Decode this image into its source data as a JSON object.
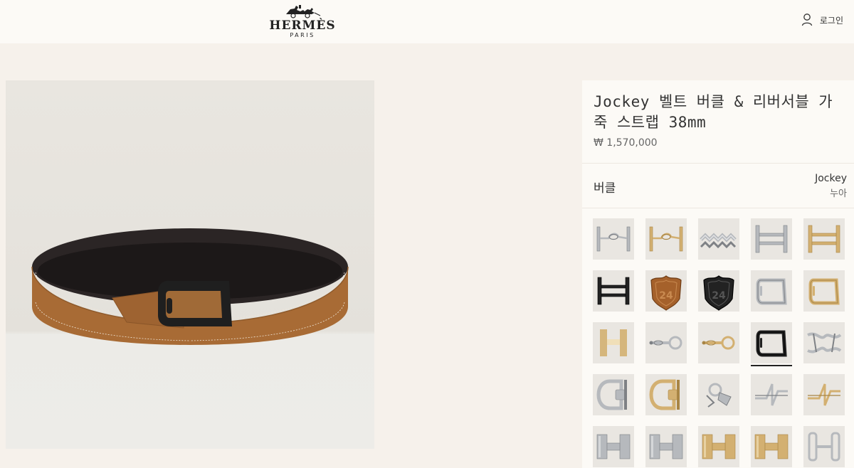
{
  "header": {
    "brand_name": "HERMÈS",
    "brand_city": "PARIS",
    "login_label": "로그인"
  },
  "product": {
    "title": "Jockey 벨트 버클 & 리버서블 가죽 스트랩 38mm",
    "price": "₩ 1,570,000"
  },
  "variant": {
    "label": "버클",
    "selected_name": "Jockey",
    "selected_color": "누아"
  },
  "colors": {
    "page_bg": "#f6f1eb",
    "panel_bg": "#fcfaf6",
    "leather": "#a86b35",
    "strap_back": "#2b2525",
    "buckle_black": "#1f1f1f",
    "silver": "#b9bcbf",
    "gold": "#d4b272"
  },
  "swatches": [
    {
      "name": "buckle-silver-horsebit",
      "color": "silver",
      "shape": "bit-h"
    },
    {
      "name": "buckle-gold-horsebit",
      "color": "gold",
      "shape": "bit-h"
    },
    {
      "name": "buckle-silver-chaine",
      "color": "silver",
      "shape": "chain"
    },
    {
      "name": "buckle-silver-h-double",
      "color": "silver",
      "shape": "double-h"
    },
    {
      "name": "buckle-gold-h-double",
      "color": "gold",
      "shape": "double-h"
    },
    {
      "name": "buckle-black-h-double",
      "color": "black",
      "shape": "double-h"
    },
    {
      "name": "buckle-leather-route-24",
      "color": "brown",
      "shape": "shield"
    },
    {
      "name": "buckle-black-route-24",
      "color": "black",
      "shape": "shield"
    },
    {
      "name": "buckle-silver-jockey",
      "color": "silver",
      "shape": "stirrup"
    },
    {
      "name": "buckle-gold-jockey",
      "color": "gold",
      "shape": "stirrup"
    },
    {
      "name": "buckle-gold-h-slim",
      "color": "gold",
      "shape": "h-slim"
    },
    {
      "name": "buckle-silver-horsebit-ring",
      "color": "silver",
      "shape": "bit-ring"
    },
    {
      "name": "buckle-gold-horsebit-ring",
      "color": "gold",
      "shape": "bit-ring"
    },
    {
      "name": "buckle-black-jockey",
      "color": "black",
      "shape": "stirrup",
      "selected": true
    },
    {
      "name": "buckle-silver-interlock",
      "color": "silver",
      "shape": "interlock"
    },
    {
      "name": "buckle-silver-d-ring",
      "color": "silver",
      "shape": "d-ring"
    },
    {
      "name": "buckle-gold-d-ring",
      "color": "gold",
      "shape": "d-ring"
    },
    {
      "name": "buckle-silver-charm",
      "color": "silver",
      "shape": "charm"
    },
    {
      "name": "buckle-silver-zigzag",
      "color": "silver",
      "shape": "zigzag"
    },
    {
      "name": "buckle-gold-zigzag",
      "color": "gold",
      "shape": "zigzag"
    },
    {
      "name": "buckle-silver-h-brushed",
      "color": "silver",
      "shape": "h-bold"
    },
    {
      "name": "buckle-silver-h-matte",
      "color": "silver",
      "shape": "h-bold"
    },
    {
      "name": "buckle-gold-h-classic",
      "color": "gold",
      "shape": "h-bold"
    },
    {
      "name": "buckle-gold-h-bold",
      "color": "gold",
      "shape": "h-bold"
    },
    {
      "name": "buckle-silver-h-open",
      "color": "silver",
      "shape": "h-open"
    }
  ]
}
